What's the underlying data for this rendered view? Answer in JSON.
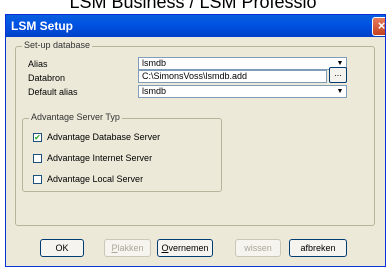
{
  "page_caption": "LSM Business / LSM Professio",
  "window": {
    "title": "LSM Setup",
    "close_glyph": "×"
  },
  "setup_group": {
    "label": "Set-up database"
  },
  "fields": [
    {
      "label": "Alias",
      "value": "lsmdb",
      "type": "combo"
    },
    {
      "label": "Databron",
      "value": "C:\\SimonsVoss\\lsmdb.add",
      "type": "text"
    },
    {
      "label": "Default alias",
      "value": "lsmdb",
      "type": "combo"
    }
  ],
  "browse_label": "...",
  "server_group": {
    "label": "Advantage Server Typ",
    "options": [
      {
        "label": "Advantage Database Server",
        "checked": true
      },
      {
        "label": "Advantage Internet Server",
        "checked": false
      },
      {
        "label": "Advantage Local Server",
        "checked": false
      }
    ]
  },
  "buttons": [
    {
      "label": "OK",
      "enabled": true
    },
    {
      "label": "Plakken",
      "enabled": false
    },
    {
      "label": "Overnemen",
      "enabled": true
    },
    {
      "label": "wissen",
      "enabled": false
    },
    {
      "label": "afbreken",
      "enabled": true
    }
  ],
  "check_glyph": "✔"
}
